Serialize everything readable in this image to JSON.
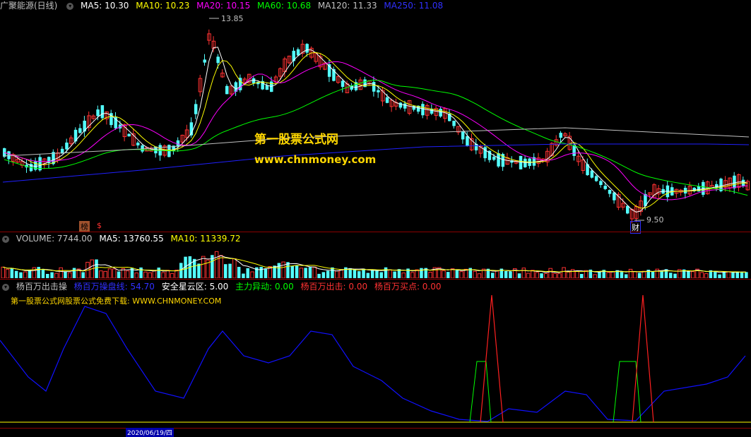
{
  "header_main": {
    "title": "广聚能源(日线)",
    "ma5": "MA5: 10.30",
    "ma10": "MA10: 10.23",
    "ma20": "MA20: 10.15",
    "ma60": "MA60: 10.68",
    "ma120": "MA120: 11.33",
    "ma250": "MA250: 11.08"
  },
  "header_volume": {
    "volume": "VOLUME: 7744.00",
    "ma5": "MA5: 13760.55",
    "ma10": "MA10: 11339.72"
  },
  "header_indicator": {
    "name": "杨百万出击操",
    "line1": "杨百万操盘线: 54.70",
    "line2": "安全星云区: 5.00",
    "line3": "主力异动: 0.00",
    "line4": "杨百万出击: 0.00",
    "line5": "杨百万买点: 0.00"
  },
  "watermark": {
    "line1": "第一股票公式网",
    "line2": "www.chnmoney.com",
    "note": "第一股票公式网股票公式免费下载: WWW.CHNMONEY.COM"
  },
  "labels": {
    "high_price": "13.85",
    "low_price": "9.50",
    "badge_bang": "榜",
    "badge_dollar": "$",
    "badge_cai": "财"
  },
  "bottom_axis": {
    "date": "2020/06/19/四"
  },
  "colors": {
    "up": "#ff3232",
    "down": "#54ffff",
    "ma5": "#ffffff",
    "ma10": "#ffff00",
    "ma20": "#ff00ff",
    "ma60": "#00ff00",
    "ma120": "#c0c0c0",
    "ma250": "#0000ff",
    "osc": "#1010ff",
    "zone": "#00ff00",
    "signal": "#ff2020"
  }
}
